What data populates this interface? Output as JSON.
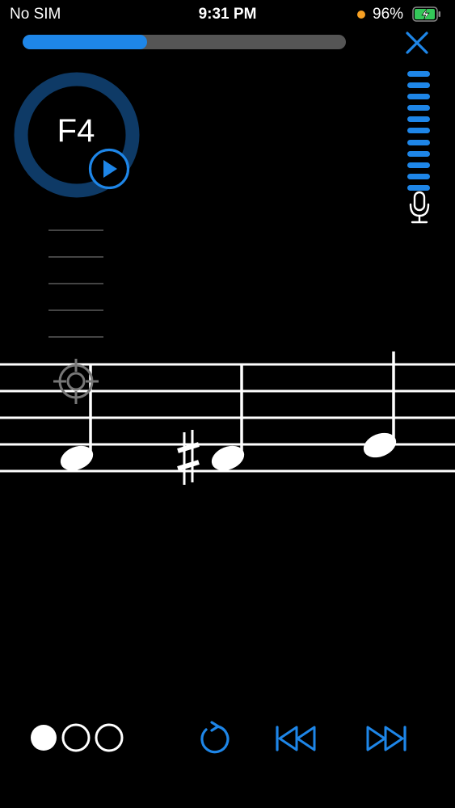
{
  "status_bar": {
    "carrier": "No SIM",
    "time": "9:31 PM",
    "battery_percent": "96%",
    "battery_level": 0.96,
    "privacy_indicator_color": "#f7a023",
    "battery_color": "#34c759"
  },
  "progress": {
    "fraction": 0.385
  },
  "pitch": {
    "note": "F4"
  },
  "level_meter": {
    "segments": 11,
    "active_segments": 11
  },
  "exercise": {
    "pages": 3,
    "current_page": 1,
    "notes": [
      {
        "pitch": "F4",
        "accidental": ""
      },
      {
        "pitch": "F#4",
        "accidental": "sharp"
      },
      {
        "pitch": "G4",
        "accidental": ""
      }
    ]
  },
  "icons": {
    "close": "close-icon",
    "mic": "microphone-icon",
    "play": "play-icon",
    "target": "crosshair-icon",
    "restart": "restart-icon",
    "previous": "skip-back-icon",
    "next": "skip-forward-icon"
  },
  "colors": {
    "accent": "#1e86e8",
    "background": "#000000",
    "ring": "#0e3a66",
    "track": "#555555"
  }
}
